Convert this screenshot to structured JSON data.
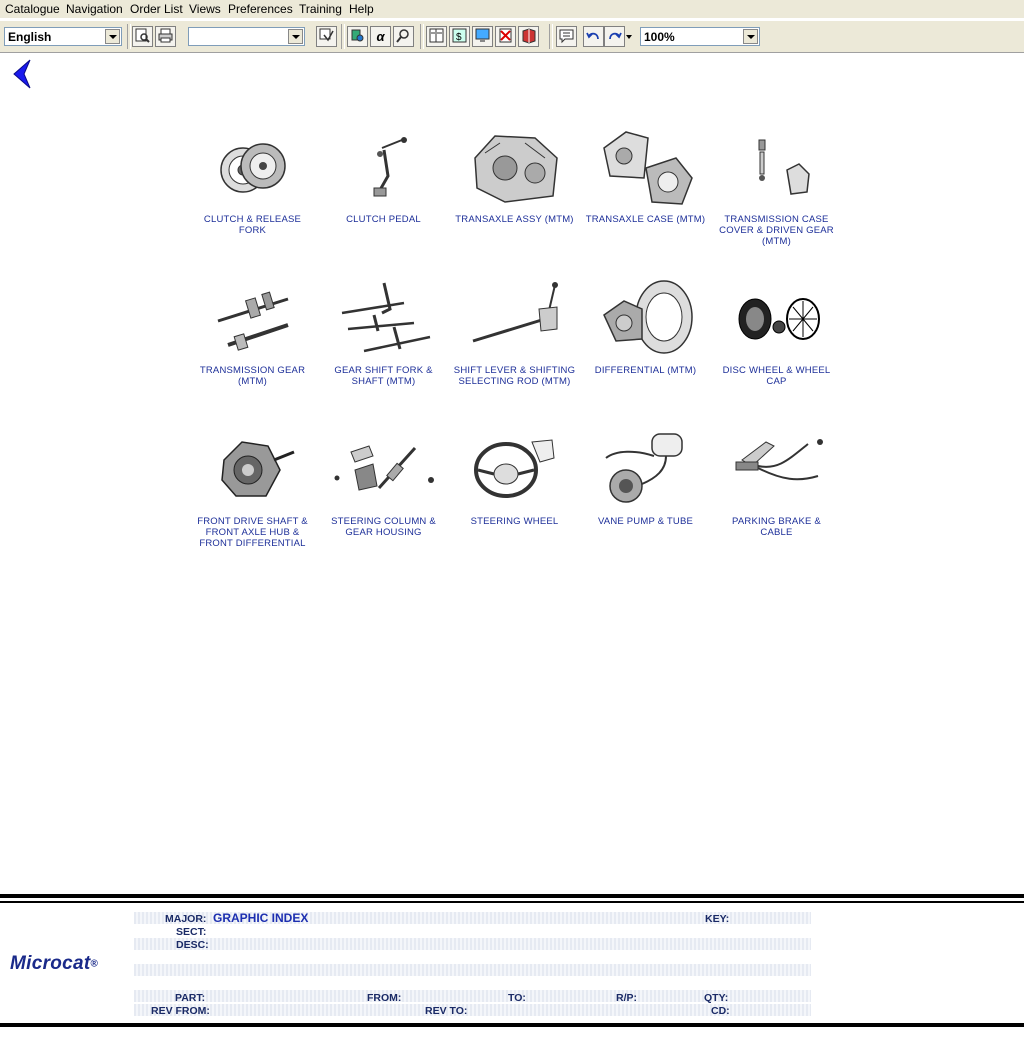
{
  "menu": [
    "Catalogue",
    "Navigation",
    "Order List",
    "Views",
    "Preferences",
    "Training",
    "Help"
  ],
  "toolbar": {
    "language": "English",
    "combo2": "",
    "zoom": "100%"
  },
  "items": [
    {
      "label": "CLUTCH & RELEASE FORK",
      "icon": "clutch-icon"
    },
    {
      "label": "CLUTCH PEDAL",
      "icon": "clutch-pedal-icon"
    },
    {
      "label": "TRANSAXLE ASSY (MTM)",
      "icon": "transaxle-assy-icon"
    },
    {
      "label": "TRANSAXLE CASE (MTM)",
      "icon": "transaxle-case-icon"
    },
    {
      "label": "TRANSMISSION CASE COVER & DRIVEN GEAR (MTM)",
      "icon": "transmission-case-cover-icon"
    },
    {
      "label": "TRANSMISSION GEAR (MTM)",
      "icon": "transmission-gear-icon"
    },
    {
      "label": "GEAR SHIFT FORK & SHAFT (MTM)",
      "icon": "gear-shift-fork-icon"
    },
    {
      "label": "SHIFT LEVER & SHIFTING SELECTING ROD (MTM)",
      "icon": "shift-lever-icon"
    },
    {
      "label": "DIFFERENTIAL (MTM)",
      "icon": "differential-icon"
    },
    {
      "label": "DISC WHEEL & WHEEL CAP",
      "icon": "disc-wheel-icon"
    },
    {
      "label": "FRONT DRIVE SHAFT & FRONT AXLE HUB & FRONT DIFFERENTIAL",
      "icon": "front-drive-shaft-icon"
    },
    {
      "label": "STEERING COLUMN & GEAR HOUSING",
      "icon": "steering-column-icon"
    },
    {
      "label": "STEERING WHEEL",
      "icon": "steering-wheel-icon"
    },
    {
      "label": "VANE PUMP & TUBE",
      "icon": "vane-pump-icon"
    },
    {
      "label": "PARKING BRAKE & CABLE",
      "icon": "parking-brake-icon"
    }
  ],
  "footer": {
    "major_label": "MAJOR:",
    "major_value": "GRAPHIC INDEX",
    "key_label": "KEY:",
    "sect_label": "SECT:",
    "desc_label": "DESC:",
    "part_label": "PART:",
    "from_label": "FROM:",
    "to_label": "TO:",
    "rp_label": "R/P:",
    "qty_label": "QTY:",
    "rev_from_label": "REV FROM:",
    "rev_to_label": "REV TO:",
    "cd_label": "CD:",
    "logo": "Microcat",
    "logo_mark": "®"
  },
  "colors": {
    "label_blue": "#1d2f99",
    "back_arrow": "#1a1aee",
    "toolbar_bg": "#ece9d8"
  }
}
